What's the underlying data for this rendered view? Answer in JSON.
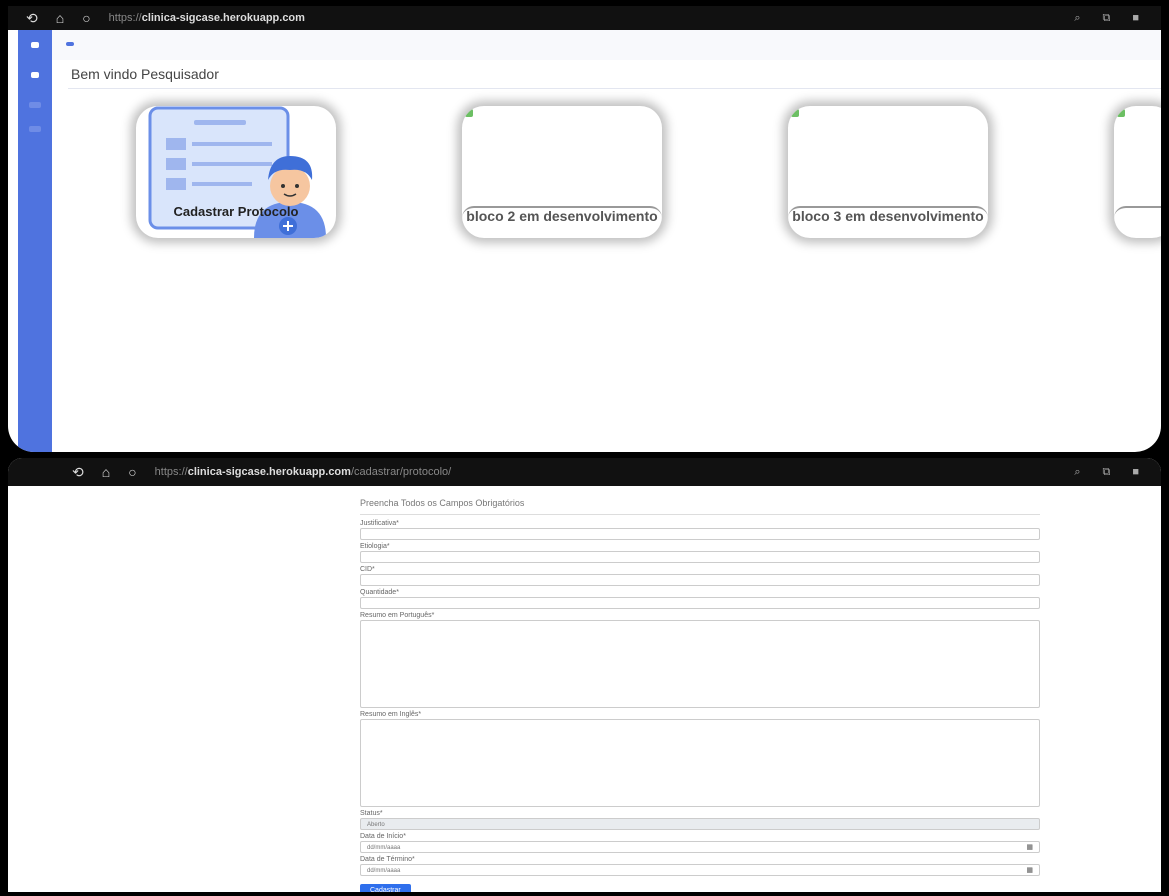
{
  "top": {
    "browser": {
      "url_host": "clinica-sigcase.herokuapp.com",
      "url_scheme": "https://"
    },
    "welcome": "Bem vindo Pesquisador",
    "cards": [
      {
        "label": "Cadastrar Protocolo"
      },
      {
        "label": "bloco 2 em desenvolvimento"
      },
      {
        "label": "bloco 3 em desenvolvimento"
      }
    ]
  },
  "bottom": {
    "browser": {
      "url_scheme": "https://",
      "url_host": "clinica-sigcase.herokuapp.com",
      "url_path": "/cadastrar/protocolo/"
    },
    "form": {
      "title": "Preencha Todos os Campos Obrigatórios",
      "fields": {
        "justificativa": "Justificativa*",
        "etiologia": "Etiologia*",
        "cid": "CID*",
        "quantidade": "Quantidade*",
        "resumo_pt": "Resumo em Português*",
        "resumo_en": "Resumo em Inglês*",
        "status": "Status*",
        "status_value": "Aberto",
        "data_inicio": "Data de Início*",
        "data_inicio_placeholder": "dd/mm/aaaa",
        "data_termino": "Data de Término*",
        "data_termino_placeholder": "dd/mm/aaaa"
      },
      "submit": "Cadastrar"
    }
  }
}
